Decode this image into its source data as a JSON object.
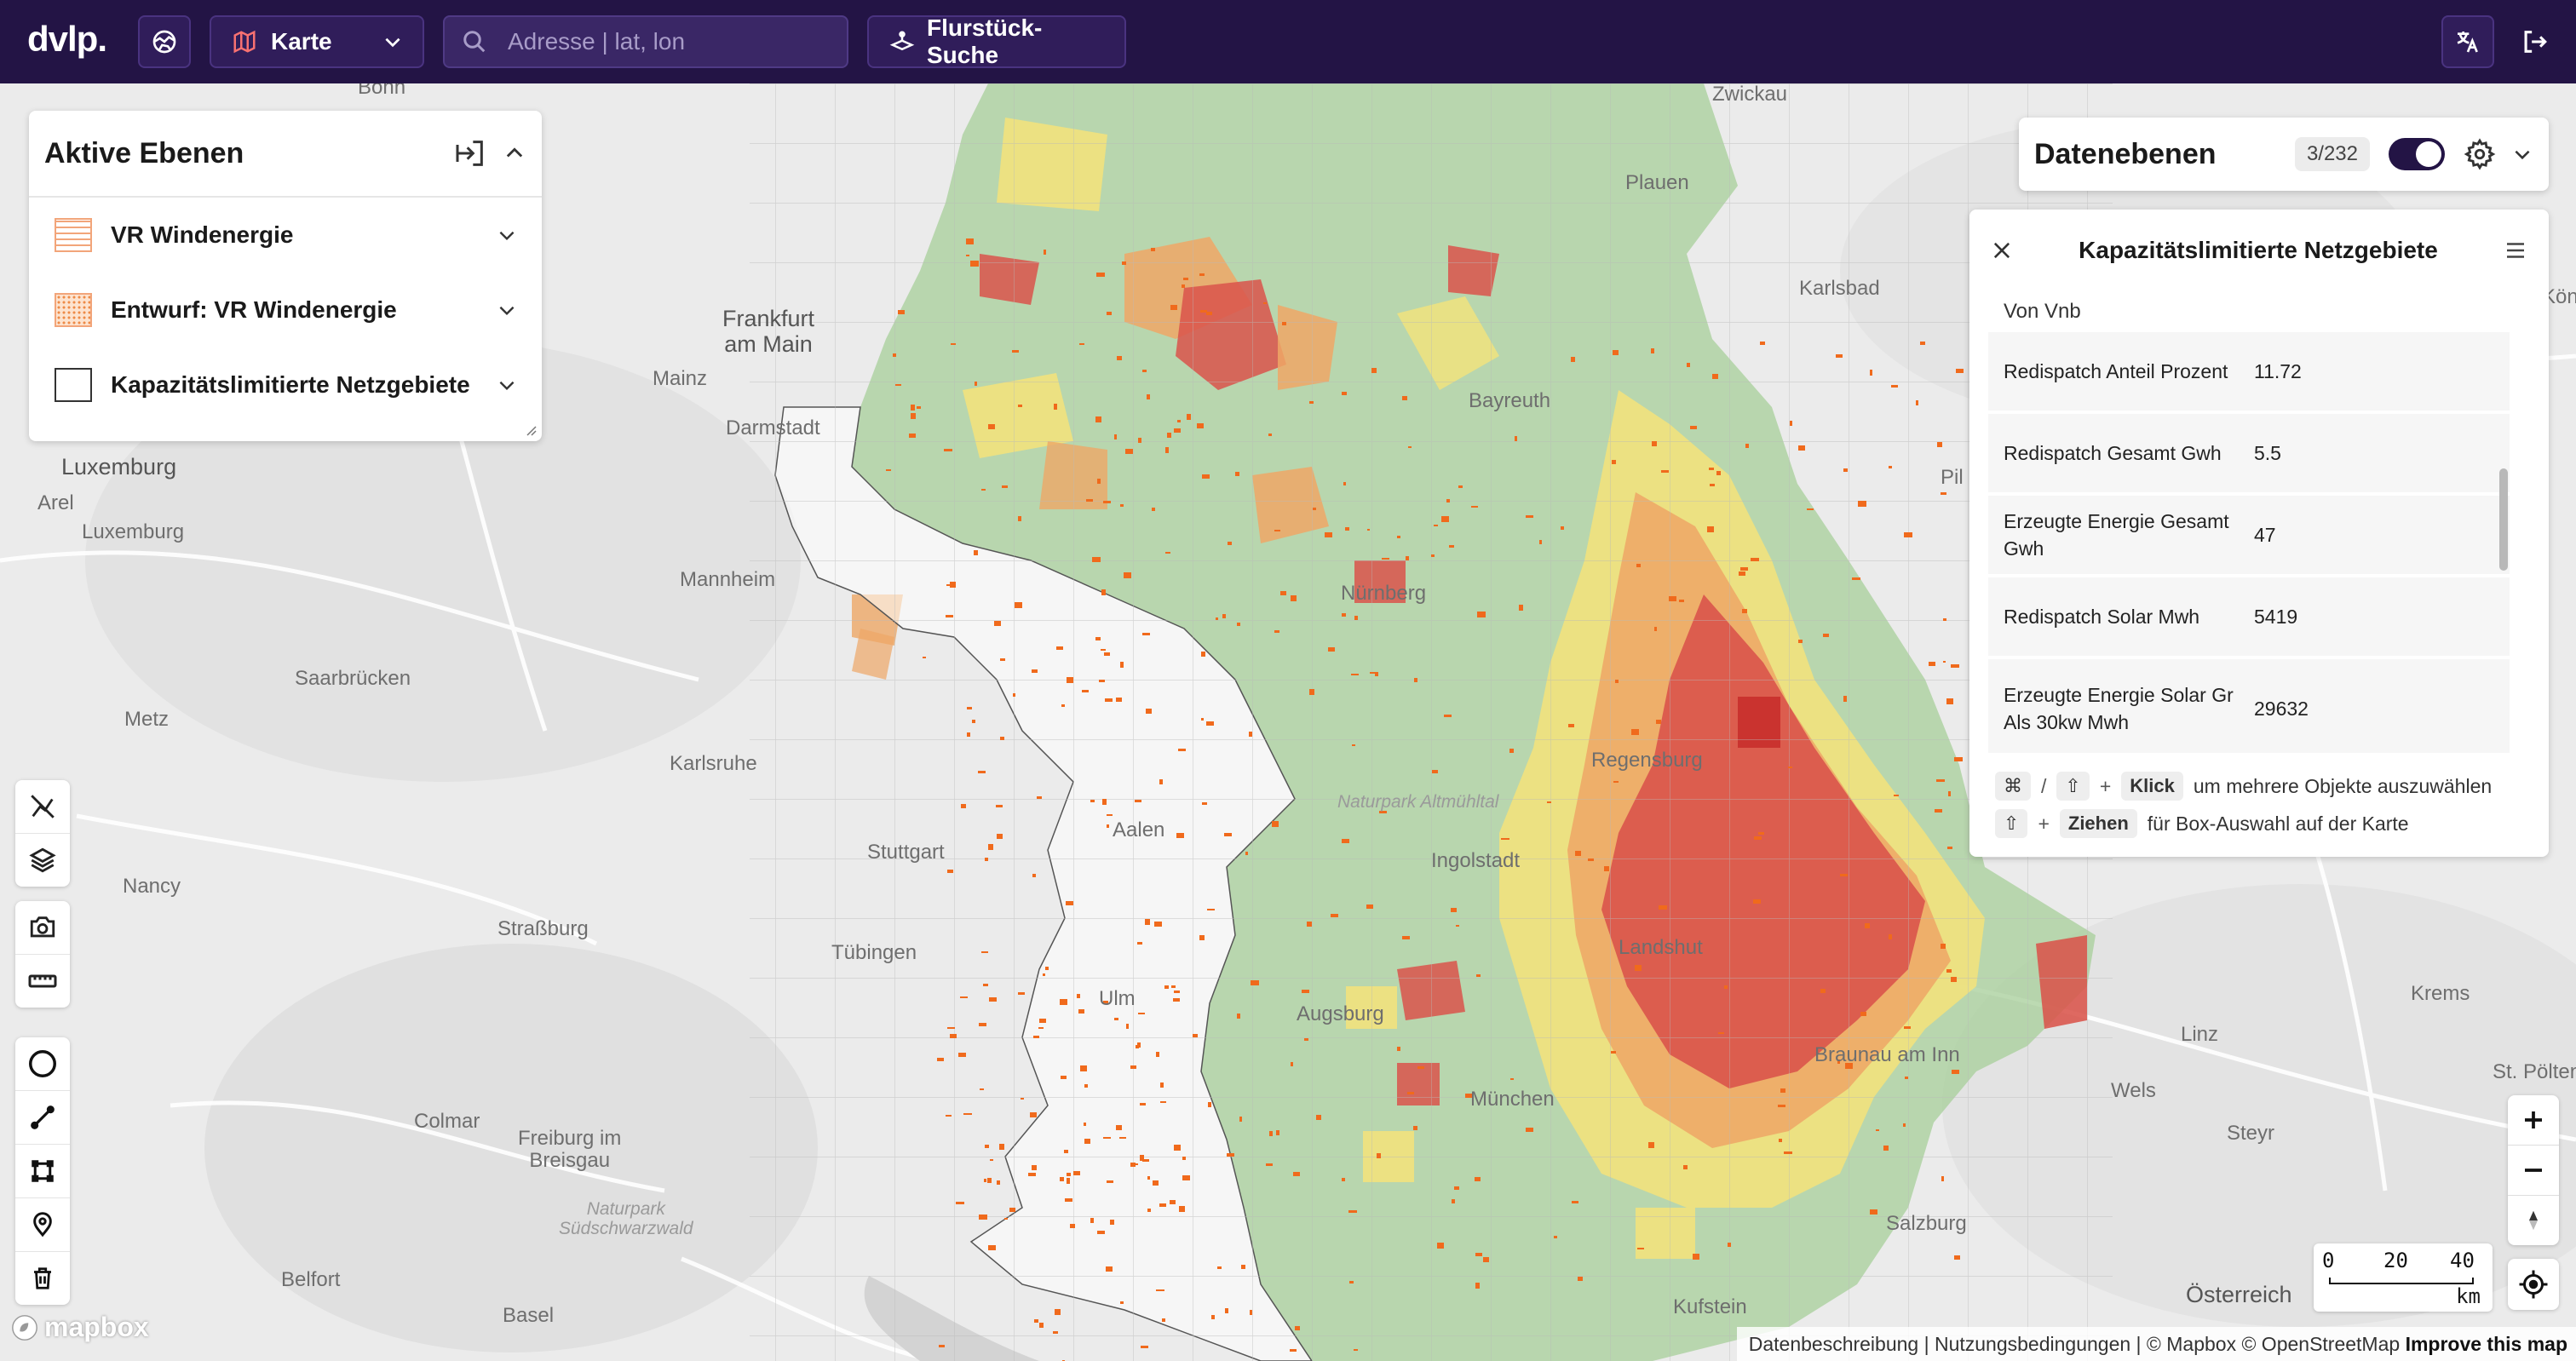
{
  "app": {
    "logo": "dvlp."
  },
  "topbar": {
    "map_style_label": "Karte",
    "search_placeholder": "Adresse | lat, lon",
    "parcel_search_label": "Flurstück-Suche"
  },
  "active_layers": {
    "title": "Aktive Ebenen",
    "items": [
      {
        "label": "VR Windenergie"
      },
      {
        "label": "Entwurf: VR Windenergie"
      },
      {
        "label": "Kapazitätslimitierte Netzgebiete"
      }
    ]
  },
  "data_layers": {
    "title": "Datenebenen",
    "count": "3/232"
  },
  "feature_popup": {
    "title": "Kapazitätslimitierte Netzgebiete",
    "cut_row": "Von Vnb",
    "rows": [
      {
        "key": "Redispatch Anteil Prozent",
        "value": "11.72"
      },
      {
        "key": "Redispatch Gesamt Gwh",
        "value": "5.5"
      },
      {
        "key": "Erzeugte Energie Gesamt Gwh",
        "value": "47"
      },
      {
        "key": "Redispatch Solar Mwh",
        "value": "5419"
      },
      {
        "key": "Erzeugte Energie Solar Gr Als 30kw Mwh",
        "value": "29632"
      }
    ],
    "hint1": {
      "key_cmd": "⌘",
      "slash": "/",
      "key_shift": "⇧",
      "plus": "+",
      "key_click": "Klick",
      "text": "um mehrere Objekte auszuwählen"
    },
    "hint2": {
      "key_shift": "⇧",
      "plus": "+",
      "key_drag": "Ziehen",
      "text": "für Box-Auswahl auf der Karte"
    }
  },
  "scale": {
    "t0": "0",
    "t1": "20",
    "t2": "40",
    "unit": "km"
  },
  "attribution": {
    "links": "Datenbeschreibung | Nutzungsbedingungen | © Mapbox © OpenStreetMap",
    "improve": "Improve this map"
  },
  "mapbox_logo": "mapbox",
  "map_labels": [
    {
      "id": "bonn",
      "text": "Bonn"
    },
    {
      "id": "zwickau",
      "text": "Zwickau"
    },
    {
      "id": "plauen",
      "text": "Plauen"
    },
    {
      "id": "frankfurt",
      "text": "Frankfurt\nam Main"
    },
    {
      "id": "mainz",
      "text": "Mainz"
    },
    {
      "id": "darmstadt",
      "text": "Darmstadt"
    },
    {
      "id": "karlsbad",
      "text": "Karlsbad"
    },
    {
      "id": "kon",
      "text": "Kön"
    },
    {
      "id": "luxemburg_big",
      "text": "Luxemburg"
    },
    {
      "id": "arel",
      "text": "Arel"
    },
    {
      "id": "luxemburg",
      "text": "Luxemburg"
    },
    {
      "id": "bayreuth",
      "text": "Bayreuth"
    },
    {
      "id": "pil",
      "text": "Pil"
    },
    {
      "id": "mannheim",
      "text": "Mannheim"
    },
    {
      "id": "nurnberg",
      "text": "Nürnberg"
    },
    {
      "id": "saarbrucken",
      "text": "Saarbrücken"
    },
    {
      "id": "metz",
      "text": "Metz"
    },
    {
      "id": "karlsruhe",
      "text": "Karlsruhe"
    },
    {
      "id": "regensburg",
      "text": "Regensburg"
    },
    {
      "id": "altmuhltal",
      "text": "Naturpark Altmühltal"
    },
    {
      "id": "aalen",
      "text": "Aalen"
    },
    {
      "id": "stuttgart",
      "text": "Stuttgart"
    },
    {
      "id": "ingolstadt",
      "text": "Ingolstadt"
    },
    {
      "id": "nancy",
      "text": "Nancy"
    },
    {
      "id": "strassburg",
      "text": "Straßburg"
    },
    {
      "id": "tubingen",
      "text": "Tübingen"
    },
    {
      "id": "landshut",
      "text": "Landshut"
    },
    {
      "id": "krems",
      "text": "Krems"
    },
    {
      "id": "ulm",
      "text": "Ulm"
    },
    {
      "id": "augsburg",
      "text": "Augsburg"
    },
    {
      "id": "linz",
      "text": "Linz"
    },
    {
      "id": "passau",
      "text": "Braunau am Inn"
    },
    {
      "id": "wels",
      "text": "Wels"
    },
    {
      "id": "stpolten",
      "text": "St. Pölten"
    },
    {
      "id": "colmar",
      "text": "Colmar"
    },
    {
      "id": "freiburg",
      "text": "Freiburg im\nBreisgau"
    },
    {
      "id": "munchen",
      "text": "München"
    },
    {
      "id": "steyr",
      "text": "Steyr"
    },
    {
      "id": "schwarzwald",
      "text": "Naturpark\nSüdschwarzwald"
    },
    {
      "id": "salzburg",
      "text": "Salzburg"
    },
    {
      "id": "belfort",
      "text": "Belfort"
    },
    {
      "id": "basel",
      "text": "Basel"
    },
    {
      "id": "kufstein",
      "text": "Kufstein"
    },
    {
      "id": "osterreich",
      "text": "Österreich"
    }
  ],
  "colors": {
    "topbar": "#231445",
    "green": "#a9cf9c",
    "yellow": "#f4e37a",
    "orange": "#eea766",
    "red": "#d9544b",
    "wind_dots": "#f06a1c"
  }
}
